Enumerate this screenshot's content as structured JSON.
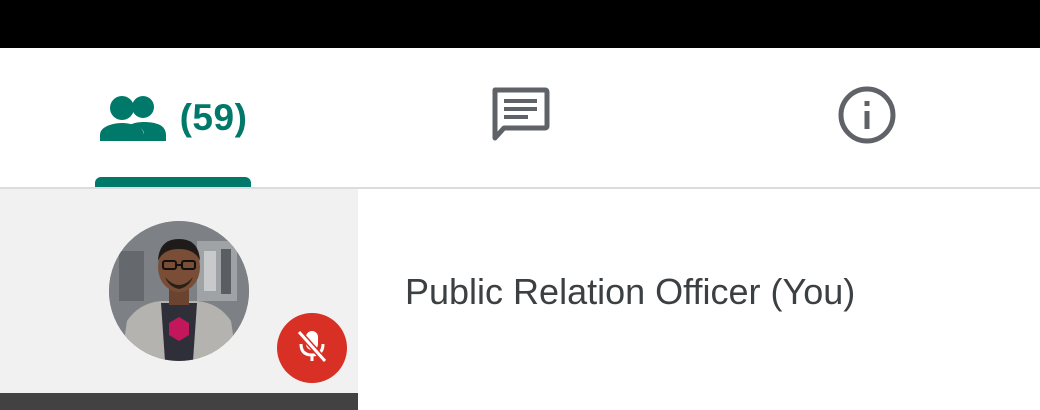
{
  "tabs": {
    "people": {
      "icon": "people-icon",
      "count_label": "(59)",
      "selected": true
    },
    "chat": {
      "icon": "chat-icon"
    },
    "info": {
      "icon": "info-icon"
    }
  },
  "participants": [
    {
      "name": "Public Relation Officer (You)",
      "avatar": "avatar-photo",
      "mic_status": "muted",
      "mic_icon": "mic-off-icon"
    }
  ],
  "colors": {
    "accent": "#00796b",
    "muted_badge": "#d93025",
    "tile_background": "#f1f1f1",
    "icon_gray": "#5f6368",
    "name_text": "#3c4043"
  }
}
